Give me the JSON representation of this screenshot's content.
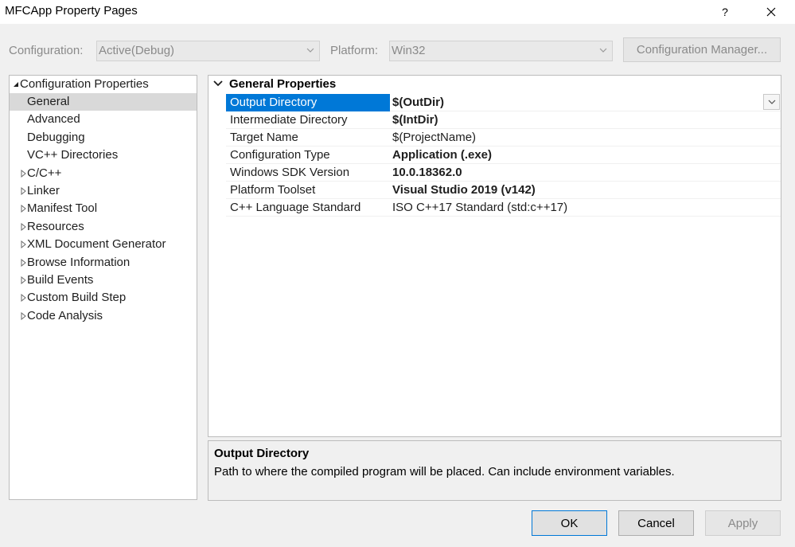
{
  "window": {
    "title": "MFCApp Property Pages",
    "help_label": "?"
  },
  "config_row": {
    "configuration_label": "Configuration:",
    "configuration_value": "Active(Debug)",
    "platform_label": "Platform:",
    "platform_value": "Win32",
    "config_manager_label": "Configuration Manager..."
  },
  "tree": {
    "root": "Configuration Properties",
    "items": [
      {
        "label": "General",
        "expandable": false,
        "selected": true
      },
      {
        "label": "Advanced",
        "expandable": false,
        "selected": false
      },
      {
        "label": "Debugging",
        "expandable": false,
        "selected": false
      },
      {
        "label": "VC++ Directories",
        "expandable": false,
        "selected": false
      },
      {
        "label": "C/C++",
        "expandable": true,
        "selected": false
      },
      {
        "label": "Linker",
        "expandable": true,
        "selected": false
      },
      {
        "label": "Manifest Tool",
        "expandable": true,
        "selected": false
      },
      {
        "label": "Resources",
        "expandable": true,
        "selected": false
      },
      {
        "label": "XML Document Generator",
        "expandable": true,
        "selected": false
      },
      {
        "label": "Browse Information",
        "expandable": true,
        "selected": false
      },
      {
        "label": "Build Events",
        "expandable": true,
        "selected": false
      },
      {
        "label": "Custom Build Step",
        "expandable": true,
        "selected": false
      },
      {
        "label": "Code Analysis",
        "expandable": true,
        "selected": false
      }
    ]
  },
  "grid": {
    "section_title": "General Properties",
    "properties": [
      {
        "name": "Output Directory",
        "value": "$(OutDir)",
        "bold": true,
        "selected": true
      },
      {
        "name": "Intermediate Directory",
        "value": "$(IntDir)",
        "bold": true,
        "selected": false
      },
      {
        "name": "Target Name",
        "value": "$(ProjectName)",
        "bold": false,
        "selected": false
      },
      {
        "name": "Configuration Type",
        "value": "Application (.exe)",
        "bold": true,
        "selected": false
      },
      {
        "name": "Windows SDK Version",
        "value": "10.0.18362.0",
        "bold": true,
        "selected": false
      },
      {
        "name": "Platform Toolset",
        "value": "Visual Studio 2019 (v142)",
        "bold": true,
        "selected": false
      },
      {
        "name": "C++ Language Standard",
        "value": "ISO C++17 Standard (std:c++17)",
        "bold": false,
        "selected": false
      }
    ]
  },
  "description": {
    "title": "Output Directory",
    "text": "Path to where the compiled program will be placed. Can include environment variables."
  },
  "buttons": {
    "ok": "OK",
    "cancel": "Cancel",
    "apply": "Apply"
  },
  "colors": {
    "selection_blue": "#0078d7",
    "tree_selection": "#d9d9d9",
    "disabled_text": "#8a8a8a"
  }
}
